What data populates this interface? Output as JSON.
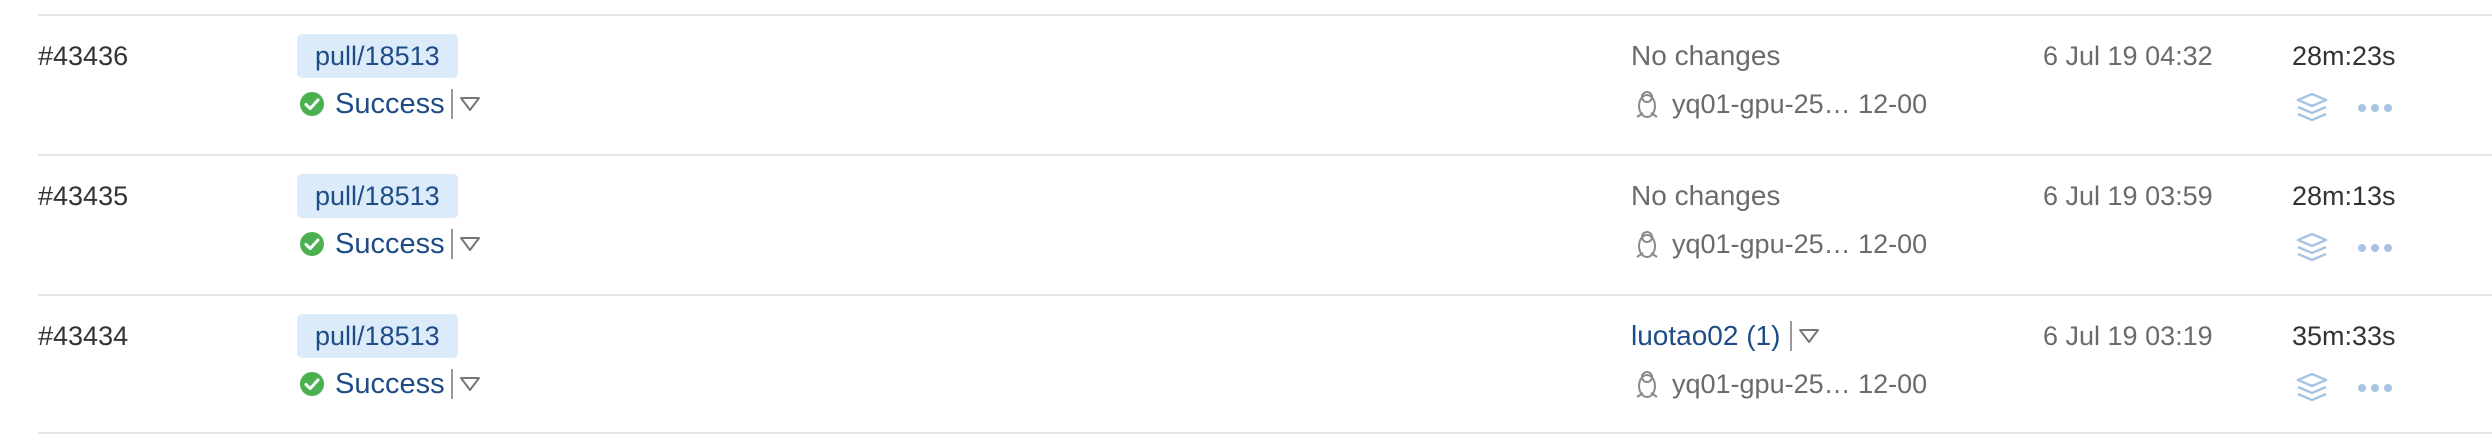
{
  "colors": {
    "link": "#1d4c86",
    "branch_bg": "#dcebfa",
    "success": "#4caf50",
    "muted": "#6b6b6b",
    "icon_light": "#a9c4e2",
    "divider": "#e4e4e4"
  },
  "icons": {
    "status": "check-circle-icon",
    "dropdown": "triangle-down-icon",
    "agent": "linux-penguin-icon",
    "actions": [
      "layers-icon",
      "more-horizontal-icon"
    ]
  },
  "builds": [
    {
      "number": "#43436",
      "branch": "pull/18513",
      "status": "Success",
      "changes": "No changes",
      "changes_is_link": false,
      "agent": "yq01-gpu-25… 12-00",
      "start_time": "6 Jul 19 04:32",
      "duration": "28m:23s"
    },
    {
      "number": "#43435",
      "branch": "pull/18513",
      "status": "Success",
      "changes": "No changes",
      "changes_is_link": false,
      "agent": "yq01-gpu-25… 12-00",
      "start_time": "6 Jul 19 03:59",
      "duration": "28m:13s"
    },
    {
      "number": "#43434",
      "branch": "pull/18513",
      "status": "Success",
      "changes": "luotao02 (1)",
      "changes_is_link": true,
      "agent": "yq01-gpu-25… 12-00",
      "start_time": "6 Jul 19 03:19",
      "duration": "35m:33s"
    }
  ]
}
